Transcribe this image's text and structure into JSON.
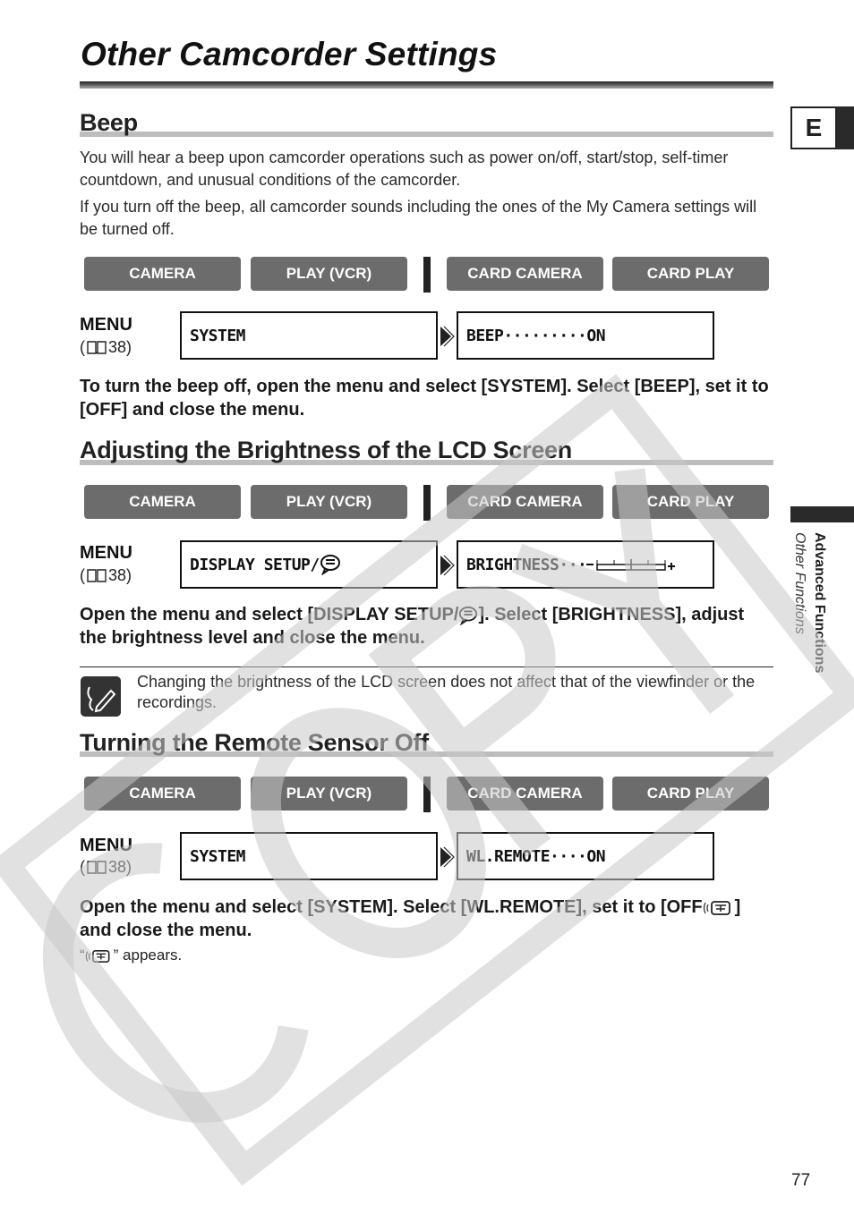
{
  "page": {
    "title": "Other Camcorder Settings",
    "language_tab": "E",
    "chapter": "Advanced Functions",
    "subchapter": "Other Functions",
    "page_number": "77",
    "watermark": "COPY"
  },
  "modes": [
    "CAMERA",
    "PLAY (VCR)",
    "CARD CAMERA",
    "CARD PLAY"
  ],
  "menu_label": "MENU",
  "menu_ref_page": "38)",
  "menu_ref_open": "(",
  "sections": {
    "beep": {
      "heading": "Beep",
      "para1": "You will hear a beep upon camcorder operations such as power on/off, start/stop, self-timer countdown, and unusual conditions of the camcorder.",
      "para2": "If you turn off the beep, all camcorder sounds including the ones of the My Camera settings will be turned off.",
      "lcd_left": "SYSTEM",
      "lcd_right": "BEEP·········ON",
      "instruction": "To turn the beep off, open the menu and select [SYSTEM]. Select [BEEP], set it to [OFF] and close the menu."
    },
    "brightness": {
      "heading": "Adjusting the Brightness of the LCD Screen",
      "lcd_left": "DISPLAY SETUP/",
      "lcd_right": "BRIGHTNESS···",
      "brightness_level": 0.5,
      "instruction_part1": "Open the menu and select [DISPLAY SETUP/",
      "instruction_part2": "]. Select [BRIGHTNESS], adjust the brightness level and close the menu.",
      "note": "Changing the brightness of the LCD screen does not affect that of the viewfinder or the recordings."
    },
    "remote": {
      "heading": "Turning the Remote Sensor Off",
      "lcd_left": "SYSTEM",
      "lcd_right": "WL.REMOTE····ON",
      "instruction_part1": "Open the menu and select [SYSTEM]. Select [WL.REMOTE], set it to [OFF",
      "instruction_part2": "] and close the menu.",
      "appears_open": "“",
      "appears_close": "” appears."
    }
  }
}
